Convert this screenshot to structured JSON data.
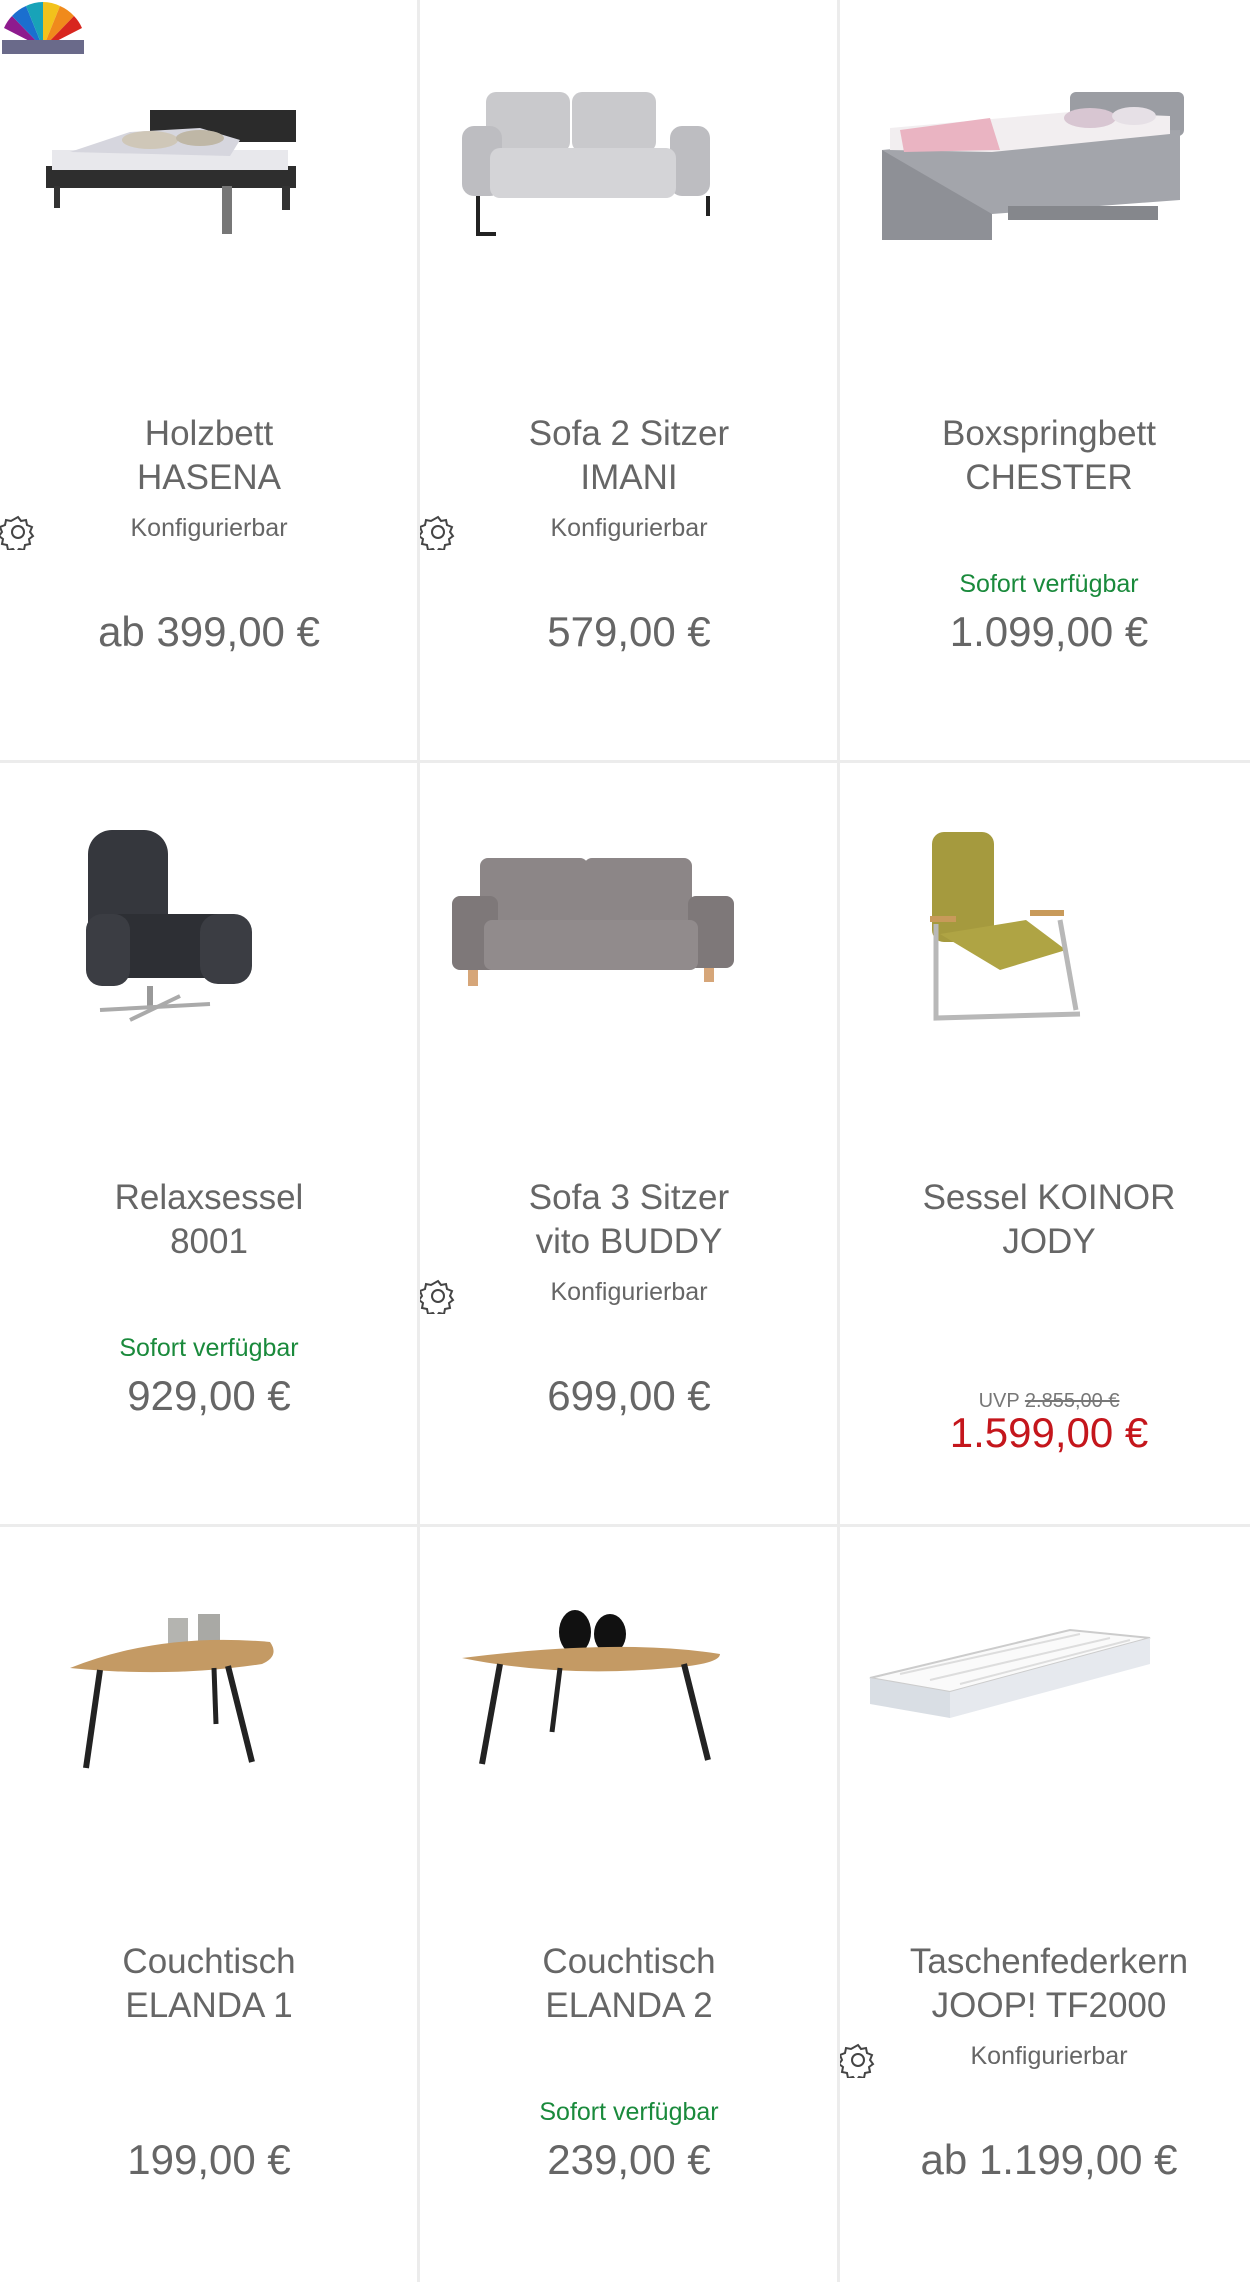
{
  "products": [
    {
      "name_line1": "Holzbett",
      "name_line2": "HASENA",
      "configurable_label": "Konfigurierbar",
      "price": "ab 399,00 €",
      "image": "bed-icon",
      "has_color_swatch": true
    },
    {
      "name_line1": "Sofa 2 Sitzer",
      "name_line2": "IMANI",
      "configurable_label": "Konfigurierbar",
      "price": "579,00 €",
      "image": "sofa-icon"
    },
    {
      "name_line1": "Boxspringbett",
      "name_line2": "CHESTER",
      "availability": "Sofort verfügbar",
      "price": "1.099,00 €",
      "image": "boxspring-bed-icon"
    },
    {
      "name_line1": "Relaxsessel",
      "name_line2": "8001",
      "availability": "Sofort verfügbar",
      "price": "929,00 €",
      "image": "recliner-icon"
    },
    {
      "name_line1": "Sofa 3 Sitzer",
      "name_line2": "vito BUDDY",
      "configurable_label": "Konfigurierbar",
      "price": "699,00 €",
      "image": "sofa-icon"
    },
    {
      "name_line1": "Sessel KOINOR",
      "name_line2": "JODY",
      "uvp_label": "UVP",
      "uvp_price": "2.855,00 €",
      "price": "1.599,00 €",
      "image": "armchair-icon"
    },
    {
      "name_line1": "Couchtisch",
      "name_line2": "ELANDA 1",
      "price": "199,00 €",
      "image": "coffee-table-icon"
    },
    {
      "name_line1": "Couchtisch",
      "name_line2": "ELANDA 2",
      "availability": "Sofort verfügbar",
      "price": "239,00 €",
      "image": "coffee-table-icon"
    },
    {
      "name_line1": "Taschenfederkern",
      "name_line2": "JOOP! TF2000",
      "configurable_label": "Konfigurierbar",
      "price": "ab 1.199,00 €",
      "image": "mattress-icon"
    }
  ],
  "colors": {
    "available": "#1a8a3c",
    "sale": "#c4161c",
    "text": "#666666",
    "divider": "#ececec"
  }
}
